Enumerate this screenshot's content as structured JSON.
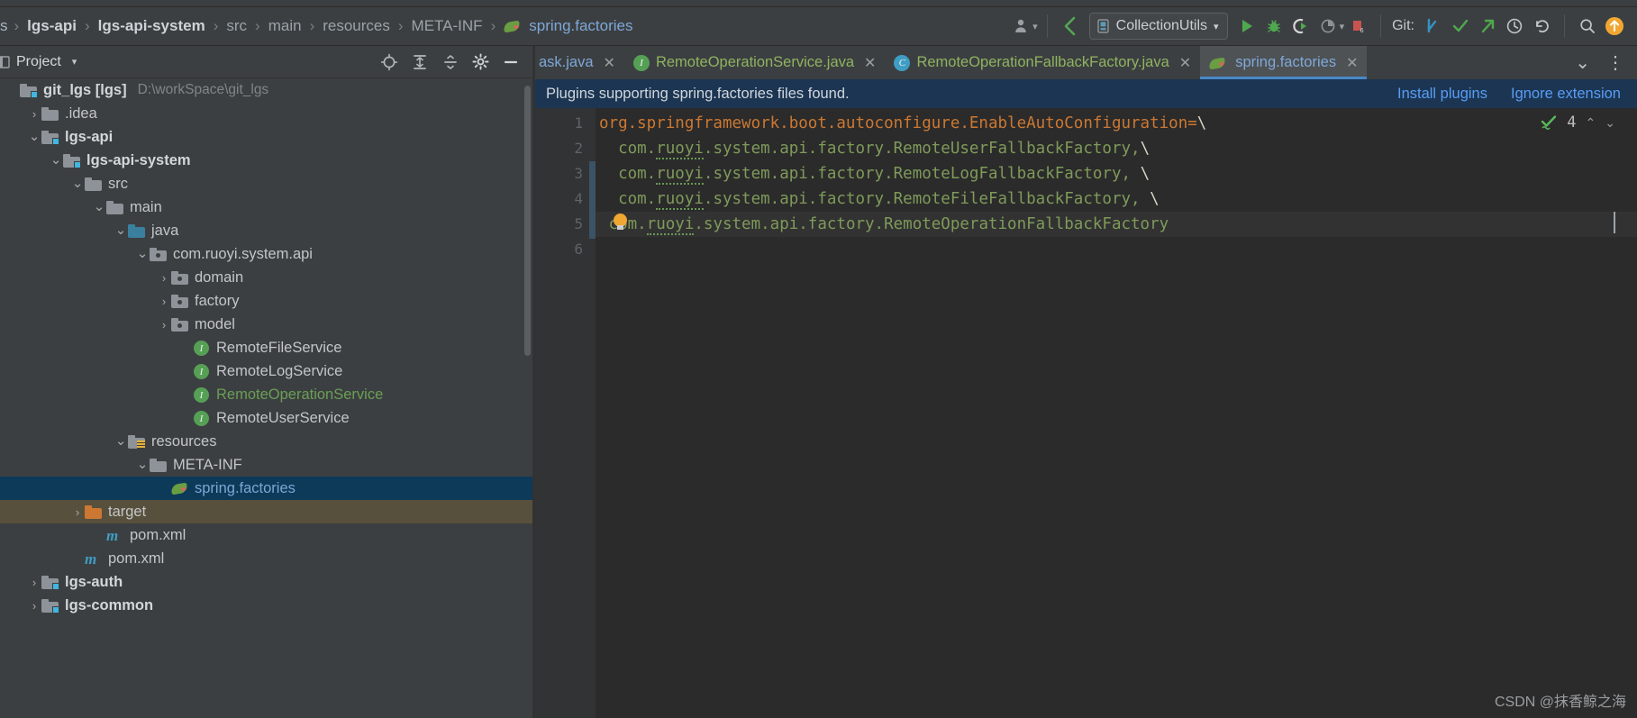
{
  "window": {
    "breadcrumb": {
      "truncated_prefix": "s",
      "items": [
        {
          "label": "lgs-api",
          "style": "bold"
        },
        {
          "label": "lgs-api-system",
          "style": "bold"
        },
        {
          "label": "src",
          "style": "dim"
        },
        {
          "label": "main",
          "style": "dim"
        },
        {
          "label": "resources",
          "style": "dim"
        },
        {
          "label": "META-INF",
          "style": "dim"
        },
        {
          "label": "spring.factories",
          "style": "file",
          "icon": "spring-leaf-icon"
        }
      ],
      "separator": "›"
    },
    "toolbar": {
      "profile_icon": "user-profile-icon",
      "profile_caret": "▾",
      "back_icon": "back-arrow-icon",
      "run_config": {
        "icon": "run-config-icon",
        "label": "CollectionUtils",
        "caret": "▾"
      },
      "run_icon": "run-icon",
      "debug_icon": "debug-icon",
      "run_coverage_icon": "run-with-coverage-icon",
      "profiler_icon": "profiler-icon",
      "profiler_caret": "▾",
      "stop_icon": "stop-icon",
      "git_label": "Git:",
      "git_update_icon": "git-update-project-icon",
      "git_commit_icon": "git-commit-icon",
      "git_push_icon": "git-push-icon",
      "history_icon": "history-icon",
      "undo_icon": "undo-icon",
      "search_icon": "search-everywhere-icon",
      "updates_icon": "updates-available-icon"
    }
  },
  "sidebar": {
    "title": "Project",
    "title_icon": "project-view-icon",
    "title_caret": "▾",
    "actions": [
      {
        "name": "scroll-from-source-icon",
        "glyph": "target"
      },
      {
        "name": "expand-all-icon",
        "glyph": "expand"
      },
      {
        "name": "collapse-all-icon",
        "glyph": "collapse"
      },
      {
        "name": "settings-gear-icon",
        "glyph": "gear"
      },
      {
        "name": "hide-panel-icon",
        "glyph": "minus"
      }
    ],
    "tree": [
      {
        "label": "git_lgs [lgs]",
        "path": "D:\\workSpace\\git_lgs",
        "indent": 0,
        "twisty": "",
        "icon": "module-folder-icon",
        "bold": true,
        "selected": "none"
      },
      {
        "label": ".idea",
        "path": "",
        "indent": 1,
        "twisty": "›",
        "icon": "folder-icon",
        "bold": false,
        "selected": "none"
      },
      {
        "label": "lgs-api",
        "path": "",
        "indent": 1,
        "twisty": "⌄",
        "icon": "module-folder-icon",
        "bold": true,
        "selected": "none"
      },
      {
        "label": "lgs-api-system",
        "path": "",
        "indent": 2,
        "twisty": "⌄",
        "icon": "module-folder-icon",
        "bold": true,
        "selected": "none"
      },
      {
        "label": "src",
        "path": "",
        "indent": 3,
        "twisty": "⌄",
        "icon": "folder-icon",
        "bold": false,
        "selected": "none"
      },
      {
        "label": "main",
        "path": "",
        "indent": 4,
        "twisty": "⌄",
        "icon": "folder-icon",
        "bold": false,
        "selected": "none"
      },
      {
        "label": "java",
        "path": "",
        "indent": 5,
        "twisty": "⌄",
        "icon": "source-root-folder-icon",
        "bold": false,
        "selected": "none"
      },
      {
        "label": "com.ruoyi.system.api",
        "path": "",
        "indent": 6,
        "twisty": "⌄",
        "icon": "package-icon",
        "bold": false,
        "selected": "none"
      },
      {
        "label": "domain",
        "path": "",
        "indent": 7,
        "twisty": "›",
        "icon": "package-icon",
        "bold": false,
        "selected": "none"
      },
      {
        "label": "factory",
        "path": "",
        "indent": 7,
        "twisty": "›",
        "icon": "package-icon",
        "bold": false,
        "selected": "none"
      },
      {
        "label": "model",
        "path": "",
        "indent": 7,
        "twisty": "›",
        "icon": "package-icon",
        "bold": false,
        "selected": "none"
      },
      {
        "label": "RemoteFileService",
        "path": "",
        "indent": 8,
        "twisty": "",
        "icon": "interface-icon",
        "bold": false,
        "selected": "none"
      },
      {
        "label": "RemoteLogService",
        "path": "",
        "indent": 8,
        "twisty": "",
        "icon": "interface-icon",
        "bold": false,
        "selected": "none"
      },
      {
        "label": "RemoteOperationService",
        "path": "",
        "indent": 8,
        "twisty": "",
        "icon": "interface-icon",
        "bold": false,
        "selected": "none",
        "color": "#6a9e55"
      },
      {
        "label": "RemoteUserService",
        "path": "",
        "indent": 8,
        "twisty": "",
        "icon": "interface-icon",
        "bold": false,
        "selected": "none"
      },
      {
        "label": "resources",
        "path": "",
        "indent": 5,
        "twisty": "⌄",
        "icon": "resource-root-folder-icon",
        "bold": false,
        "selected": "none"
      },
      {
        "label": "META-INF",
        "path": "",
        "indent": 6,
        "twisty": "⌄",
        "icon": "folder-icon",
        "bold": false,
        "selected": "none"
      },
      {
        "label": "spring.factories",
        "path": "",
        "indent": 7,
        "twisty": "",
        "icon": "spring-leaf-icon",
        "bold": false,
        "selected": "blue"
      },
      {
        "label": "target",
        "path": "",
        "indent": 3,
        "twisty": "›",
        "icon": "excluded-folder-icon",
        "bold": false,
        "selected": "olive"
      },
      {
        "label": "pom.xml",
        "path": "",
        "indent": 4,
        "twisty": "",
        "icon": "maven-icon",
        "bold": false,
        "selected": "none"
      },
      {
        "label": "pom.xml",
        "path": "",
        "indent": 3,
        "twisty": "",
        "icon": "maven-icon",
        "bold": false,
        "selected": "none"
      },
      {
        "label": "lgs-auth",
        "path": "",
        "indent": 1,
        "twisty": "›",
        "icon": "module-folder-icon",
        "bold": true,
        "selected": "none"
      },
      {
        "label": "lgs-common",
        "path": "",
        "indent": 1,
        "twisty": "›",
        "icon": "module-folder-icon",
        "bold": true,
        "selected": "none"
      }
    ]
  },
  "editor": {
    "tabs": [
      {
        "label": "ask.java",
        "icon": "none",
        "close": "✕",
        "active": false,
        "clipped": true
      },
      {
        "label": "RemoteOperationService.java",
        "icon": "interface-icon",
        "close": "✕",
        "active": false,
        "clipped": false
      },
      {
        "label": "RemoteOperationFallbackFactory.java",
        "icon": "class-icon",
        "close": "✕",
        "active": false,
        "clipped": false
      },
      {
        "label": "spring.factories",
        "icon": "spring-leaf-icon",
        "close": "✕",
        "active": true,
        "clipped": false
      }
    ],
    "tabs_right": [
      {
        "name": "tab-list-chevron-icon",
        "glyph": "⌄"
      },
      {
        "name": "tab-options-icon",
        "glyph": "⋮"
      }
    ],
    "notification": {
      "message": "Plugins supporting spring.factories files found.",
      "actions": [
        {
          "label": "Install plugins"
        },
        {
          "label": "Ignore extension"
        }
      ]
    },
    "inspection_widget": {
      "icon": "inspections-ok-icon",
      "count": "4",
      "prev_icon": "⌃",
      "next_icon": "⌄"
    },
    "line_numbers": [
      "1",
      "2",
      "3",
      "4",
      "5",
      "6"
    ],
    "lines": [
      {
        "n": 1,
        "segments": [
          {
            "text": "org.springframework.boot.autoconfigure.EnableAutoConfiguration",
            "kind": "key"
          },
          {
            "text": "=",
            "kind": "key"
          },
          {
            "text": "\\",
            "kind": "escape"
          }
        ]
      },
      {
        "n": 2,
        "segments": [
          {
            "text": "  com.",
            "kind": "value"
          },
          {
            "text": "ruoyi",
            "kind": "value-typo"
          },
          {
            "text": ".system.api.factory.RemoteUserFallbackFactory,",
            "kind": "value"
          },
          {
            "text": "\\",
            "kind": "escape"
          }
        ]
      },
      {
        "n": 3,
        "segments": [
          {
            "text": "  com.",
            "kind": "value"
          },
          {
            "text": "ruoyi",
            "kind": "value-typo"
          },
          {
            "text": ".system.api.factory.RemoteLogFallbackFactory, ",
            "kind": "value"
          },
          {
            "text": "\\",
            "kind": "escape"
          }
        ]
      },
      {
        "n": 4,
        "segments": [
          {
            "text": "  com.",
            "kind": "value"
          },
          {
            "text": "ruoyi",
            "kind": "value-typo"
          },
          {
            "text": ".system.api.factory.RemoteFileFallbackFactory, ",
            "kind": "value"
          },
          {
            "text": "\\",
            "kind": "escape"
          }
        ]
      },
      {
        "n": 5,
        "segments": [
          {
            "text": " com.",
            "kind": "value"
          },
          {
            "text": "ruoyi",
            "kind": "value-typo"
          },
          {
            "text": ".system.api.factory.RemoteOperationFallbackFactory",
            "kind": "value"
          }
        ],
        "gutter_icon": "intention-bulb-icon",
        "current": true
      },
      {
        "n": 6,
        "segments": []
      }
    ]
  },
  "watermark": "CSDN @抹香鲸之海",
  "colors": {
    "panel_bg": "#3c3f41",
    "editor_bg": "#2b2b2b",
    "gutter_bg": "#313335",
    "selection_blue": "#0d3a58",
    "selection_olive": "#57503c",
    "notification_bg": "#1c3552",
    "link_blue": "#589df6",
    "key_orange": "#cc7832",
    "value_green": "#7f9a5a",
    "tab_green": "#8fb360",
    "accent_blue": "#4a88c7"
  }
}
